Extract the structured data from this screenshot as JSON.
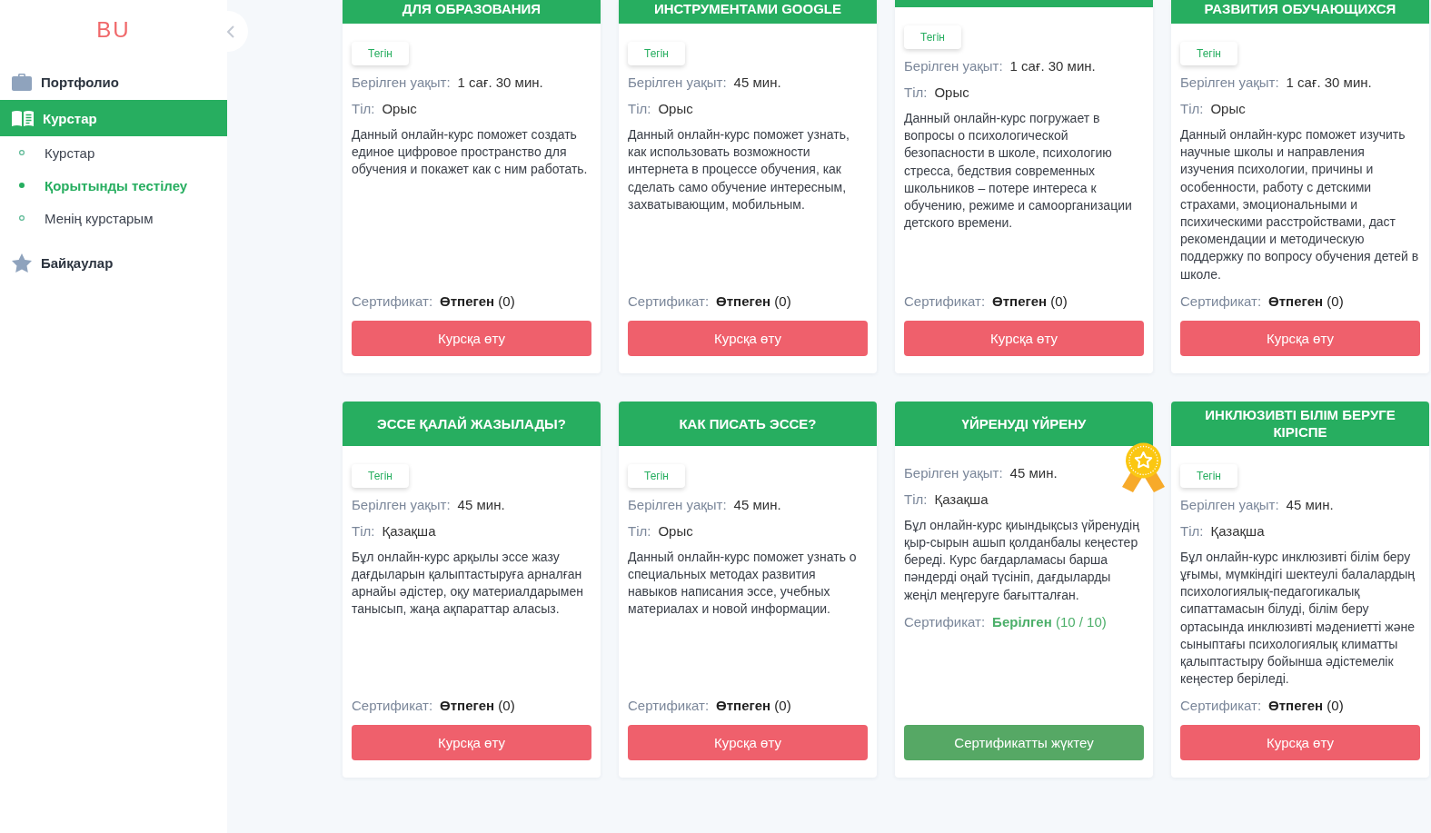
{
  "sidebar": {
    "logo": "BU",
    "items": [
      {
        "label": "Портфолио",
        "selected": false
      },
      {
        "label": "Курстар",
        "selected": true,
        "children": [
          {
            "label": "Курстар",
            "selected": false
          },
          {
            "label": "Қорытынды тестілеу",
            "selected": true
          },
          {
            "label": "Менің курстарым",
            "selected": false
          }
        ]
      },
      {
        "label": "Байқаулар",
        "selected": false
      }
    ]
  },
  "rows": [
    {
      "cut_at_top": true,
      "cards": [
        {
          "title": "ДЛЯ ОБРАЗОВАНИЯ",
          "badge": "Тегін",
          "duration": {
            "label": "Берілген уақыт:",
            "value": "1 сағ. 30 мин."
          },
          "language": {
            "label": "Тіл:",
            "value": "Орыс"
          },
          "description": "Данный онлайн-курс поможет создать единое цифровое пространство для обучения и покажет как с ним работать.",
          "completed": false,
          "certificate": {
            "label": "Сертификат:",
            "value": "**Өтпеген** (0)"
          },
          "button": {
            "label": "Курсқа өту",
            "kind": "enter"
          }
        },
        {
          "title": "ИНСТРУМЕНТАМИ GOOGLE",
          "badge": "Тегін",
          "duration": {
            "label": "Берілген уақыт:",
            "value": "45 мин."
          },
          "language": {
            "label": "Тіл:",
            "value": "Орыс"
          },
          "description": "Данный онлайн-курс поможет узнать, как использовать возможности интернета в процессе обучения, как сделать само обучение интересным, захватывающим, мобильным.",
          "completed": false,
          "certificate": {
            "label": "Сертификат:",
            "value": "**Өтпеген** (0)"
          },
          "button": {
            "label": "Курсқа өту",
            "kind": "enter"
          }
        },
        {
          "badge": "Тегін",
          "duration": {
            "label": "Берілген уақыт:",
            "value": "1 сағ. 30 мин."
          },
          "language": {
            "label": "Тіл:",
            "value": "Орыс"
          },
          "description": "Данный онлайн-курс погружает в вопросы о психологической безопасности в школе, психологию стресса, бедствия современных школьников – потере интереса к обучению, режиме и самоорганизации детского времени.",
          "completed": false,
          "certificate": {
            "label": "Сертификат:",
            "value": "**Өтпеген** (0)"
          },
          "button": {
            "label": "Курсқа өту",
            "kind": "enter"
          }
        },
        {
          "title": "РАЗВИТИЯ ОБУЧАЮЩИХСЯ",
          "badge": "Тегін",
          "duration": {
            "label": "Берілген уақыт:",
            "value": "1 сағ. 30 мин."
          },
          "language": {
            "label": "Тіл:",
            "value": "Орыс"
          },
          "description": "Данный онлайн-курс поможет изучить научные школы и направления изучения психологии, причины и особенности, работу с детскими страхами, эмоциональными и психическими расстройствами, даст рекомендации и методическую поддержку по вопросу обучения детей в школе.",
          "completed": false,
          "certificate": {
            "label": "Сертификат:",
            "value": "**Өтпеген** (0)"
          },
          "button": {
            "label": "Курсқа өту",
            "kind": "enter"
          }
        }
      ]
    },
    {
      "cut_at_top": false,
      "cards": [
        {
          "title": "ЭССЕ ҚАЛАЙ ЖАЗЫЛАДЫ?",
          "badge": "Тегін",
          "duration": {
            "label": "Берілген уақыт:",
            "value": "45 мин."
          },
          "language": {
            "label": "Тіл:",
            "value": "Қазақша"
          },
          "description": "Бұл онлайн-курс арқылы эссе жазу дағдыларын қалыптастыруға арналған арнайы әдістер, оқу материалдарымен танысып, жаңа ақпараттар аласыз.",
          "completed": false,
          "certificate": {
            "label": "Сертификат:",
            "value": "**Өтпеген** (0)"
          },
          "button": {
            "label": "Курсқа өту",
            "kind": "enter"
          }
        },
        {
          "title": "КАК ПИСАТЬ ЭССЕ?",
          "badge": "Тегін",
          "duration": {
            "label": "Берілген уақыт:",
            "value": "45 мин."
          },
          "language": {
            "label": "Тіл:",
            "value": "Орыс"
          },
          "description": "Данный онлайн-курс поможет узнать о специальных методах развития навыков написания эссе, учебных материалах и новой информации.",
          "completed": false,
          "certificate": {
            "label": "Сертификат:",
            "value": "**Өтпеген** (0)"
          },
          "button": {
            "label": "Курсқа өту",
            "kind": "enter"
          }
        },
        {
          "title": "ҮЙРЕНУДІ ҮЙРЕНУ",
          "duration": {
            "label": "Берілген уақыт:",
            "value": "45 мин."
          },
          "language": {
            "label": "Тіл:",
            "value": "Қазақша"
          },
          "description": "Бұл онлайн-курс қиындықсыз үйренудің қыр-сырын ашып қолданбалы кеңестер береді. Курс бағдарламасы барша пәндерді оңай түсініп, дағдыларды жеңіл меңгеруге бағытталған.",
          "completed": true,
          "certificate": {
            "label": "Сертификат:",
            "value": "**Берілген** (10 / 10)"
          },
          "button": {
            "label": "Сертификатты жүктеу",
            "kind": "download"
          }
        },
        {
          "title": "ИНКЛЮЗИВТІ БІЛІМ БЕРУГЕ КІРІСПЕ",
          "badge": "Тегін",
          "duration": {
            "label": "Берілген уақыт:",
            "value": "45 мин."
          },
          "language": {
            "label": "Тіл:",
            "value": "Қазақша"
          },
          "description": "Бұл онлайн-курс инклюзивті білім беру ұғымы, мүмкіндігі шектеулі балалардың психологиялық-педагогикалық сипаттамасын білуді, білім беру ортасында инклюзивті мәдениетті және сыныптағы психологиялық климатты қалыптастыру бойынша әдістемелік кеңестер беріледі.",
          "completed": false,
          "certificate": {
            "label": "Сертификат:",
            "value": "**Өтпеген** (0)"
          },
          "button": {
            "label": "Курсқа өту",
            "kind": "enter"
          }
        }
      ]
    }
  ]
}
